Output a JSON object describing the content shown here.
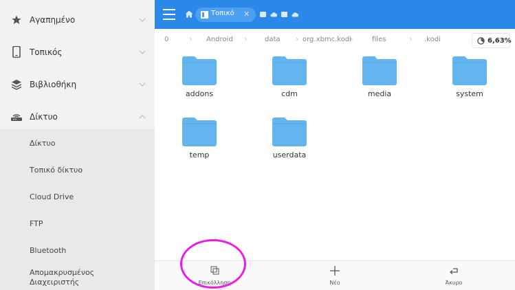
{
  "sidebar": {
    "items": [
      {
        "label": "Αγαπημένο",
        "icon": "star-icon"
      },
      {
        "label": "Τοπικός",
        "icon": "phone-icon"
      },
      {
        "label": "Βιβλιοθήκη",
        "icon": "library-icon"
      },
      {
        "label": "Δίκτυο",
        "icon": "router-icon"
      }
    ],
    "network_sub": [
      {
        "label": "Δίκτυο"
      },
      {
        "label": "Τοπικό δίκτυο"
      },
      {
        "label": "Cloud Drive"
      },
      {
        "label": "FTP"
      },
      {
        "label": "Bluetooth"
      },
      {
        "label": "Απομακρυσμένος Διαχειριστής"
      }
    ]
  },
  "header": {
    "tab_label": "Τοπικό",
    "tab_close": "✕"
  },
  "breadcrumb": [
    "0",
    "Android",
    "data",
    "org.xbmc.kodi",
    "files",
    ".kodi"
  ],
  "storage": {
    "percent": "6,63%"
  },
  "folders": [
    "addons",
    "cdm",
    "media",
    "system",
    "temp",
    "userdata"
  ],
  "bottombar": {
    "paste_label": "Επικόλληση",
    "new_label": "Νέο",
    "cancel_label": "Άκυρο"
  },
  "colors": {
    "header": "#2a88e8",
    "folder": "#64b4ee",
    "annotation": "#e81ee8"
  }
}
